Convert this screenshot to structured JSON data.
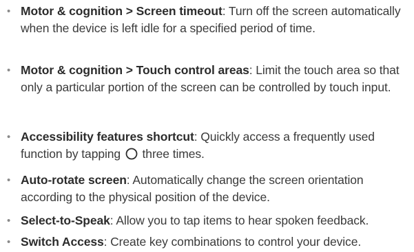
{
  "items": [
    {
      "part1": "Motor & cognition",
      "sep": " > ",
      "part2": "Screen timeout",
      "desc": ": Turn off the screen automatically when the device is left idle for a specified period of time."
    },
    {
      "part1": "Motor & cognition",
      "sep": " > ",
      "part2": "Touch control areas",
      "desc": ": Limit the touch area so that only a particular portion of the screen can be controlled by touch input."
    },
    {
      "part1": "Accessibility features shortcut",
      "desc_before_icon": ": Quickly access a frequently used function by tapping",
      "icon": "home-circle-icon",
      "desc_after_icon": "three times."
    },
    {
      "part1": "Auto-rotate screen",
      "desc": ": Automatically change the screen orientation according to the physical position of the device."
    },
    {
      "part1": "Select-to-Speak",
      "desc": ": Allow you to tap items to hear spoken feedback."
    },
    {
      "part1": "Switch Access",
      "desc": ": Create key combinations to control your device."
    }
  ]
}
